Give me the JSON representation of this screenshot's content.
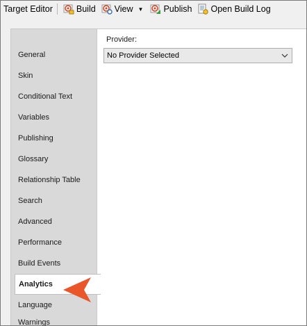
{
  "toolbar": {
    "title": "Target Editor",
    "build_label": "Build",
    "view_label": "View",
    "publish_label": "Publish",
    "open_build_log_label": "Open Build Log"
  },
  "sidebar": {
    "items": [
      {
        "label": "General"
      },
      {
        "label": "Skin"
      },
      {
        "label": "Conditional Text"
      },
      {
        "label": "Variables"
      },
      {
        "label": "Publishing"
      },
      {
        "label": "Glossary"
      },
      {
        "label": "Relationship Table"
      },
      {
        "label": "Search"
      },
      {
        "label": "Advanced"
      },
      {
        "label": "Performance"
      },
      {
        "label": "Build Events"
      },
      {
        "label": "Analytics"
      },
      {
        "label": "Language"
      },
      {
        "label": "Warnings"
      }
    ],
    "active": "Analytics"
  },
  "provider": {
    "label": "Provider:",
    "value": "No Provider Selected"
  },
  "colors": {
    "callout": "#e8562a",
    "sidebar_bg": "#d9d9d9"
  },
  "icons": [
    "build-icon",
    "view-icon",
    "publish-icon",
    "open-build-log-icon",
    "chevron-down-icon"
  ]
}
